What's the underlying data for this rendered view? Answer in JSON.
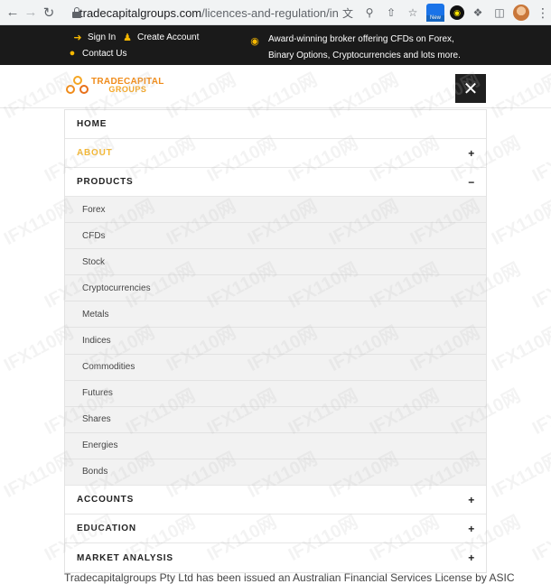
{
  "browser": {
    "url_host": "tradecapitalgroups.com",
    "url_path": "/licences-and-regulation/in...",
    "icons": [
      "back-icon",
      "forward-icon",
      "reload-icon",
      "lock-icon",
      "translate-icon",
      "zoom-icon",
      "share-icon",
      "star-icon",
      "extension-new-icon",
      "extension-dark-icon",
      "puzzle-icon",
      "sidepanel-icon",
      "profile-avatar",
      "kebab-icon"
    ],
    "new_badge": "New"
  },
  "topbar": {
    "sign_in": "Sign In",
    "create_account": "Create Account",
    "contact_us": "Contact Us",
    "award_text": "Award-winning broker offering CFDs on Forex, Binary Options, Cryptocurrencies and lots more.",
    "accent_color": "#f5b700"
  },
  "header": {
    "logo_line1": "TRADECAPITAL",
    "logo_line2": "GROUPS",
    "close_label": "✕"
  },
  "menu": {
    "home": "HOME",
    "about": "ABOUT",
    "products": "PRODUCTS",
    "accounts": "ACCOUNTS",
    "education": "EDUCATION",
    "market_analysis": "MARKET ANALYSIS",
    "expand_symbol": "+",
    "collapse_symbol": "−",
    "active_color": "#f5b731",
    "product_items": [
      "Forex",
      "CFDs",
      "Stock",
      "Cryptocurrencies",
      "Metals",
      "Indices",
      "Commodities",
      "Futures",
      "Shares",
      "Energies",
      "Bonds"
    ]
  },
  "body_text": "Tradecapitalgroups Pty Ltd has been issued an Australian Financial Services License by ASIC",
  "watermark": "IFX110网"
}
